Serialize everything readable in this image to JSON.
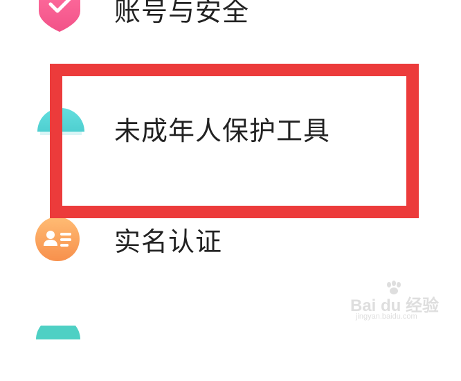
{
  "menu": {
    "items": [
      {
        "label": "账号与安全",
        "icon": "shield-check-icon",
        "icon_color": "#f45a8d"
      },
      {
        "label": "未成年人保护工具",
        "icon": "minor-protection-icon",
        "icon_color": "#5fd8d8"
      },
      {
        "label": "实名认证",
        "icon": "id-card-icon",
        "icon_color": "#f7a25a"
      },
      {
        "label": "",
        "icon": "teal-circle-icon",
        "icon_color": "#4ed0c4"
      }
    ]
  },
  "highlight": {
    "color": "#ec3b3b"
  },
  "watermark": {
    "brand": "Bai du 经验",
    "url": "jingyan.baidu.com"
  }
}
